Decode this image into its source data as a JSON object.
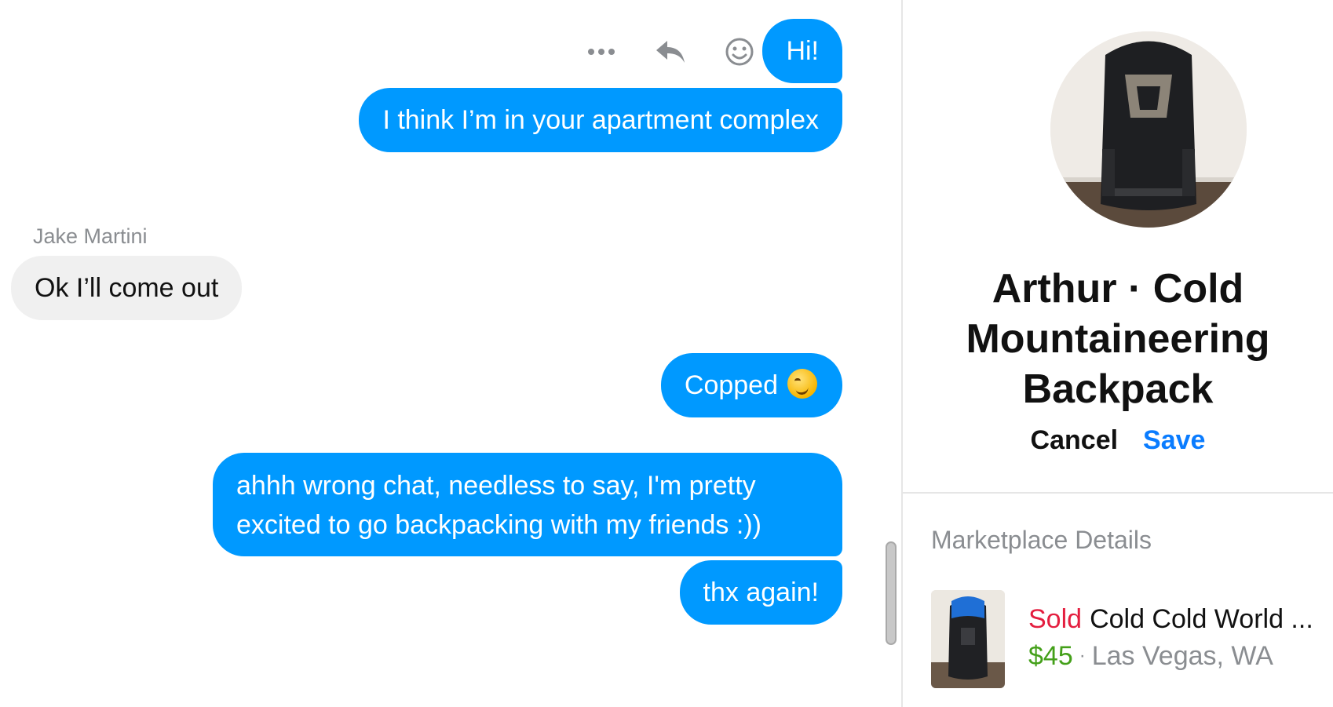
{
  "messages": {
    "m1": "Hi!",
    "m2": "I think I’m in your apartment complex",
    "sender": "Jake Martini",
    "m3": "Ok I’ll come out",
    "m4": "Copped",
    "m5": "ahhh wrong chat, needless to say, I'm pretty excited to go backpacking with my friends :))",
    "m6": "thx again!"
  },
  "message_actions": [
    "more-icon",
    "reply-icon",
    "react-emoji-icon"
  ],
  "side_panel": {
    "title": "Arthur · Cold Mountaineering Backpack",
    "cancel_label": "Cancel",
    "save_label": "Save",
    "marketplace_heading": "Marketplace Details",
    "listing": {
      "status": "Sold",
      "name": "Cold Cold World ...",
      "price": "$45",
      "separator": "·",
      "location": "Las Vegas, WA"
    }
  },
  "colors": {
    "outgoing_bubble": "#0099ff",
    "incoming_bubble": "#f0f0f0",
    "save_link": "#0a7cff",
    "sold_status": "#e41e3f",
    "price": "#44a01a"
  }
}
